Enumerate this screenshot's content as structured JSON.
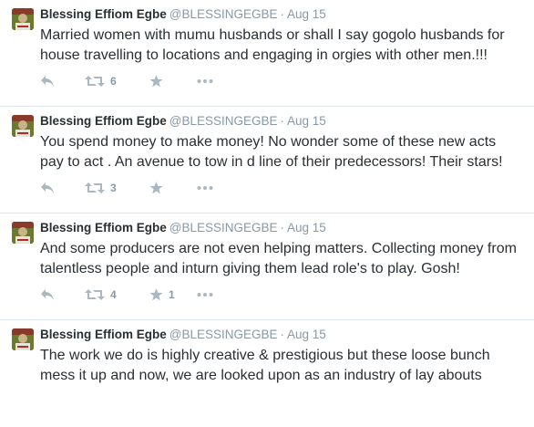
{
  "tweets": [
    {
      "author_name": "Blessing Effiom Egbe",
      "handle": "@BLESSINGEGBE",
      "separator": "·",
      "date": "Aug 15",
      "text": "Married women with mumu husbands or shall I say gogolo husbands for house travelling to locations and engaging in orgies with other men.!!!",
      "retweet_count": "6",
      "favorite_count": ""
    },
    {
      "author_name": "Blessing Effiom Egbe",
      "handle": "@BLESSINGEGBE",
      "separator": "·",
      "date": "Aug 15",
      "text": "You spend money to make money! No wonder some of these new acts pay to act . An avenue to  tow in d line of their predecessors! Their stars!",
      "retweet_count": "3",
      "favorite_count": ""
    },
    {
      "author_name": "Blessing Effiom Egbe",
      "handle": "@BLESSINGEGBE",
      "separator": "·",
      "date": "Aug 15",
      "text": "And some producers are not even helping matters. Collecting money from talentless people and inturn giving them lead role's to play. Gosh!",
      "retweet_count": "4",
      "favorite_count": "1"
    },
    {
      "author_name": "Blessing Effiom Egbe",
      "handle": "@BLESSINGEGBE",
      "separator": "·",
      "date": "Aug 15",
      "text": "The work we do is highly creative & prestigious  but these loose bunch mess it up and now, we are looked upon as an industry of lay abouts",
      "retweet_count": "",
      "favorite_count": ""
    }
  ],
  "icons": {
    "reply": "reply-icon",
    "retweet": "retweet-icon",
    "favorite": "star-icon",
    "more": "more-icon"
  },
  "colors": {
    "text": "#292f33",
    "muted": "#8899a6",
    "icon": "#aab8c2",
    "divider": "#e1e8ed"
  }
}
